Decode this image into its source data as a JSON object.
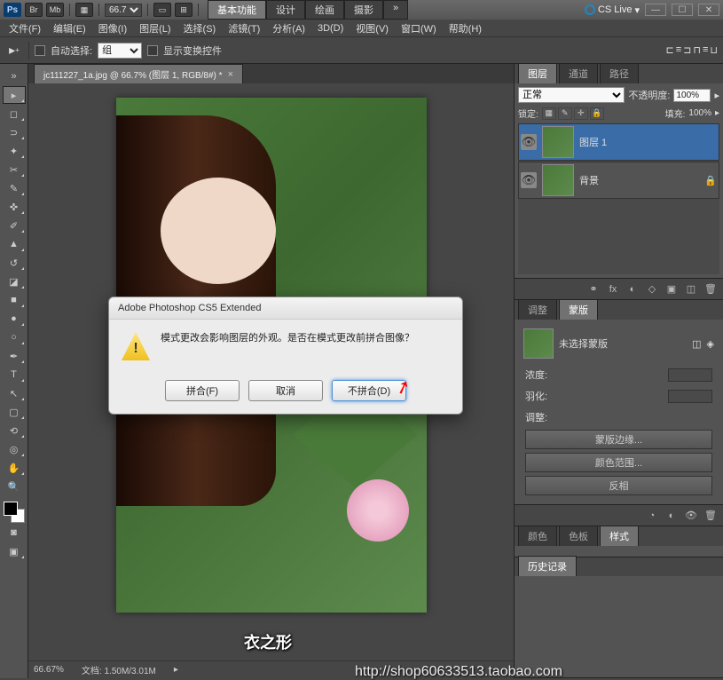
{
  "topbar": {
    "ps": "Ps",
    "chips": [
      "Br",
      "Mb"
    ],
    "zoom": "66.7",
    "tabs": [
      "基本功能",
      "设计",
      "绘画",
      "摄影"
    ],
    "active_tab": 0,
    "cslive": "CS Live",
    "winbtns": [
      "—",
      "☐",
      "✕"
    ]
  },
  "menubar": [
    "文件(F)",
    "编辑(E)",
    "图像(I)",
    "图层(L)",
    "选择(S)",
    "滤镜(T)",
    "分析(A)",
    "3D(D)",
    "视图(V)",
    "窗口(W)",
    "帮助(H)"
  ],
  "optionsbar": {
    "auto_select": "自动选择:",
    "group": "组",
    "show_transform": "显示变换控件"
  },
  "doctab": {
    "title": "jc111227_1a.jpg @ 66.7% (图层 1, RGB/8#) *",
    "close": "×"
  },
  "statusbar": {
    "zoom": "66.67%",
    "docinfo": "文档: 1.50M/3.01M"
  },
  "panels": {
    "layers": {
      "tabs": [
        "图层",
        "通道",
        "路径"
      ],
      "active": 0,
      "blend": "正常",
      "opacity_label": "不透明度:",
      "opacity": "100%",
      "lock_label": "锁定:",
      "fill_label": "填充:",
      "fill": "100%",
      "items": [
        {
          "name": "图层 1",
          "selected": true,
          "locked": false
        },
        {
          "name": "背景",
          "selected": false,
          "locked": true
        }
      ],
      "foot_icons": [
        "fx",
        "◐",
        "◇",
        "▣",
        "◫",
        "⊡",
        "🗑"
      ]
    },
    "adjustments": {
      "tabs": [
        "调整",
        "蒙版"
      ],
      "active": 1,
      "mask_label": "未选择蒙版",
      "density": "浓度:",
      "feather": "羽化:",
      "adjust_label": "调整:",
      "btn_edge": "蒙版边缘...",
      "btn_color": "颜色范围...",
      "btn_invert": "反相",
      "foot_icons": [
        "👁",
        "◐",
        "◇",
        "🗑"
      ]
    },
    "swatches": {
      "tabs": [
        "颜色",
        "色板",
        "样式"
      ],
      "active": 2,
      "history_label": "历史记录"
    }
  },
  "dialog": {
    "title": "Adobe Photoshop CS5 Extended",
    "msg": "模式更改会影响图层的外观。是否在模式更改前拼合图像？",
    "btn_flatten": "拼合(F)",
    "btn_cancel": "取消",
    "btn_dont": "不拼合(D)"
  },
  "watermark": {
    "line1": "衣之形",
    "line2": "http://shop60633513.taobao.com"
  },
  "tool_names": [
    "move",
    "marquee",
    "lasso",
    "wand",
    "crop",
    "eyedropper",
    "heal",
    "brush",
    "stamp",
    "history-brush",
    "eraser",
    "gradient",
    "blur",
    "dodge",
    "pen",
    "type",
    "path-select",
    "rectangle",
    "hand",
    "zoom",
    "rotate-3d",
    "orbit"
  ]
}
